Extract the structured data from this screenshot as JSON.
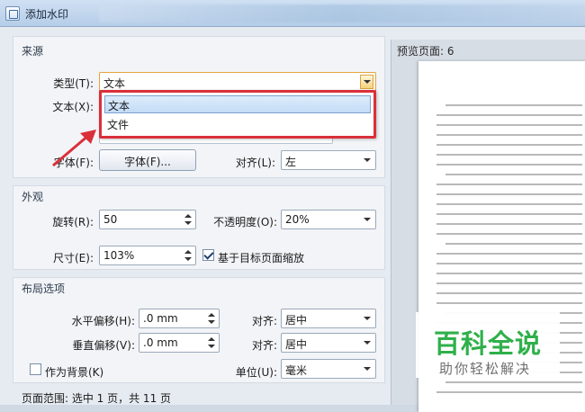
{
  "window": {
    "title": "添加水印"
  },
  "source": {
    "group_title": "来源",
    "type_label": "类型(T):",
    "type_value": "文本",
    "text_label": "文本(X):",
    "dropdown_options": [
      "文本",
      "文件"
    ],
    "font_label": "字体(F):",
    "font_button": "字体(F)...",
    "align_label": "对齐(L):",
    "align_value": "左"
  },
  "appearance": {
    "group_title": "外观",
    "rotation_label": "旋转(R):",
    "rotation_value": "50",
    "opacity_label": "不透明度(O):",
    "opacity_value": "20%",
    "size_label": "尺寸(E):",
    "size_value": "103%",
    "scale_checkbox_label": "基于目标页面缩放",
    "scale_checked": true
  },
  "layout": {
    "group_title": "布局选项",
    "h_offset_label": "水平偏移(H):",
    "h_offset_value": ".0 mm",
    "h_align_label": "对齐:",
    "h_align_value": "居中",
    "v_offset_label": "垂直偏移(V):",
    "v_offset_value": ".0 mm",
    "v_align_label": "对齐:",
    "v_align_value": "居中",
    "background_label": "作为背景(K)",
    "unit_label": "单位(U):",
    "unit_value": "毫米"
  },
  "page_range": {
    "text": "页面范围: 选中 1 页，共 11 页"
  },
  "preview": {
    "label": "预览页面: 6"
  },
  "watermark_overlay": {
    "main": "百科全说",
    "sub": "助你轻松解决"
  },
  "colors": {
    "highlight_red": "#d9303a",
    "watermark_green": "#2fb04a"
  }
}
